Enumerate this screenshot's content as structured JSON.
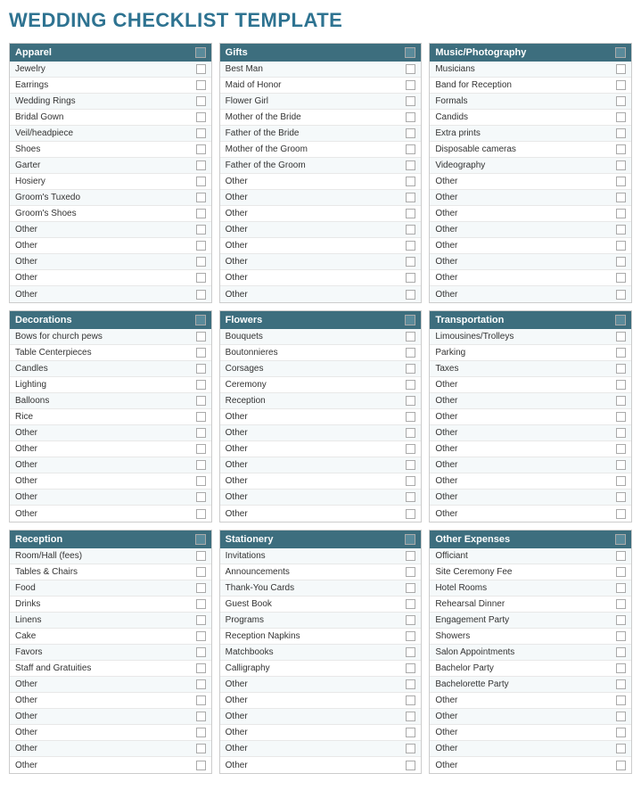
{
  "title": "WEDDING CHECKLIST TEMPLATE",
  "sections": [
    {
      "id": "apparel",
      "header": "Apparel",
      "items": [
        "Jewelry",
        "Earrings",
        "Wedding Rings",
        "Bridal Gown",
        "Veil/headpiece",
        "Shoes",
        "Garter",
        "Hosiery",
        "Groom's Tuxedo",
        "Groom's Shoes",
        "Other",
        "Other",
        "Other",
        "Other",
        "Other"
      ]
    },
    {
      "id": "gifts",
      "header": "Gifts",
      "items": [
        "Best Man",
        "Maid of Honor",
        "Flower Girl",
        "Mother of the Bride",
        "Father of the Bride",
        "Mother of the Groom",
        "Father of the Groom",
        "Other",
        "Other",
        "Other",
        "Other",
        "Other",
        "Other",
        "Other",
        "Other"
      ]
    },
    {
      "id": "music-photography",
      "header": "Music/Photography",
      "items": [
        "Musicians",
        "Band for Reception",
        "Formals",
        "Candids",
        "Extra prints",
        "Disposable cameras",
        "Videography",
        "Other",
        "Other",
        "Other",
        "Other",
        "Other",
        "Other",
        "Other",
        "Other"
      ]
    },
    {
      "id": "decorations",
      "header": "Decorations",
      "items": [
        "Bows for church pews",
        "Table Centerpieces",
        "Candles",
        "Lighting",
        "Balloons",
        "Rice",
        "Other",
        "Other",
        "Other",
        "Other",
        "Other",
        "Other"
      ]
    },
    {
      "id": "flowers",
      "header": "Flowers",
      "items": [
        "Bouquets",
        "Boutonnieres",
        "Corsages",
        "Ceremony",
        "Reception",
        "Other",
        "Other",
        "Other",
        "Other",
        "Other",
        "Other",
        "Other"
      ]
    },
    {
      "id": "transportation",
      "header": "Transportation",
      "items": [
        "Limousines/Trolleys",
        "Parking",
        "Taxes",
        "Other",
        "Other",
        "Other",
        "Other",
        "Other",
        "Other",
        "Other",
        "Other",
        "Other"
      ]
    },
    {
      "id": "reception",
      "header": "Reception",
      "items": [
        "Room/Hall (fees)",
        "Tables & Chairs",
        "Food",
        "Drinks",
        "Linens",
        "Cake",
        "Favors",
        "Staff and Gratuities",
        "Other",
        "Other",
        "Other",
        "Other",
        "Other",
        "Other"
      ]
    },
    {
      "id": "stationery",
      "header": "Stationery",
      "items": [
        "Invitations",
        "Announcements",
        "Thank-You Cards",
        "Guest Book",
        "Programs",
        "Reception Napkins",
        "Matchbooks",
        "Calligraphy",
        "Other",
        "Other",
        "Other",
        "Other",
        "Other",
        "Other"
      ]
    },
    {
      "id": "other-expenses",
      "header": "Other Expenses",
      "items": [
        "Officiant",
        "Site Ceremony Fee",
        "Hotel Rooms",
        "Rehearsal Dinner",
        "Engagement Party",
        "Showers",
        "Salon Appointments",
        "Bachelor Party",
        "Bachelorette Party",
        "Other",
        "Other",
        "Other",
        "Other",
        "Other"
      ]
    }
  ]
}
